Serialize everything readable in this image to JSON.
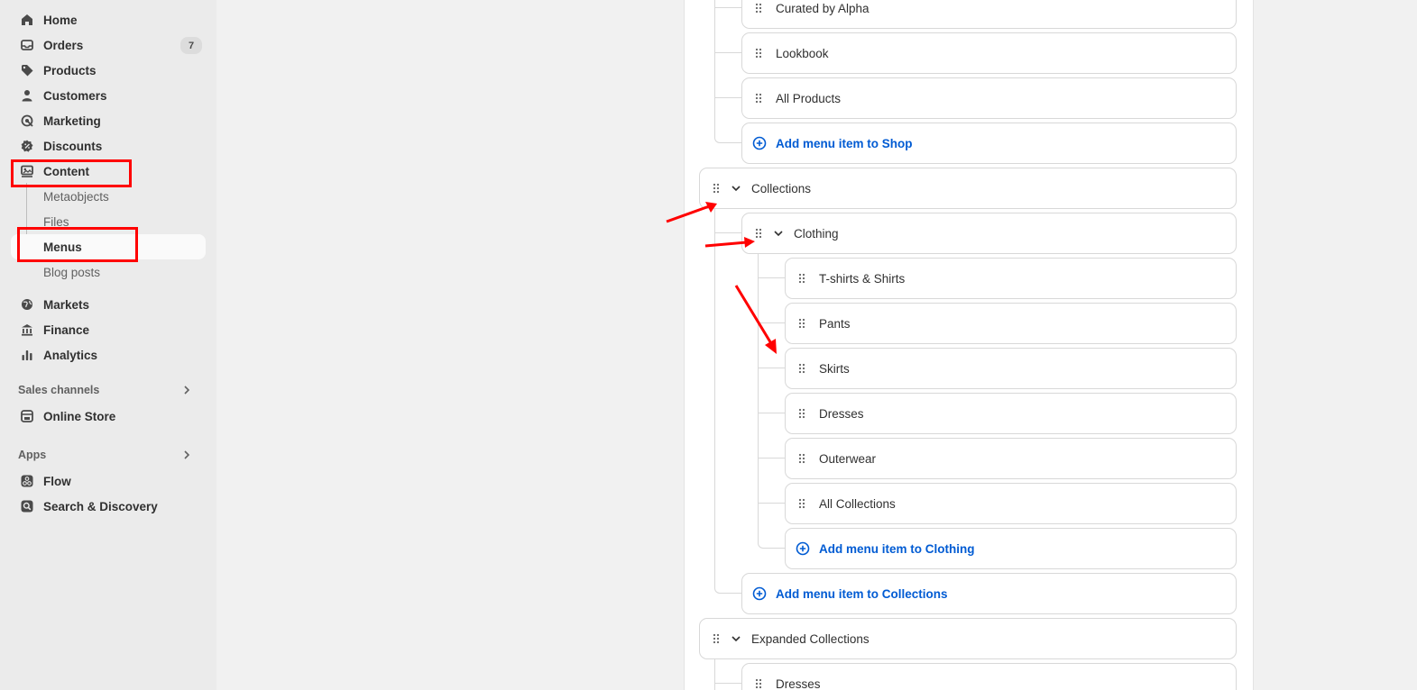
{
  "sidebar": {
    "nav": [
      {
        "label": "Home",
        "icon": "home-icon"
      },
      {
        "label": "Orders",
        "icon": "inbox-icon",
        "badge": "7"
      },
      {
        "label": "Products",
        "icon": "tag-icon"
      },
      {
        "label": "Customers",
        "icon": "person-icon"
      },
      {
        "label": "Marketing",
        "icon": "target-icon"
      },
      {
        "label": "Discounts",
        "icon": "discount-icon"
      },
      {
        "label": "Content",
        "icon": "content-icon"
      }
    ],
    "content_sub": [
      "Metaobjects",
      "Files",
      "Menus",
      "Blog posts"
    ],
    "nav2": [
      {
        "label": "Markets",
        "icon": "globe-icon"
      },
      {
        "label": "Finance",
        "icon": "bank-icon"
      },
      {
        "label": "Analytics",
        "icon": "bar-chart-icon"
      }
    ],
    "sales_channels": {
      "heading": "Sales channels",
      "items": [
        {
          "label": "Online Store",
          "icon": "store-icon"
        }
      ]
    },
    "apps": {
      "heading": "Apps",
      "items": [
        {
          "label": "Flow",
          "icon": "flow-icon"
        },
        {
          "label": "Search & Discovery",
          "icon": "search-discovery-icon"
        }
      ]
    }
  },
  "menu_tree": {
    "shop_children": [
      "Curated by Alpha",
      "Lookbook",
      "All Products"
    ],
    "add_shop": "Add menu item to Shop",
    "collections": "Collections",
    "clothing": "Clothing",
    "clothing_children": [
      "T-shirts & Shirts",
      "Pants",
      "Skirts",
      "Dresses",
      "Outerwear",
      "All Collections"
    ],
    "add_clothing": "Add menu item to Clothing",
    "add_collections": "Add menu item to Collections",
    "expanded_collections": "Expanded Collections",
    "expanded_children": [
      "Dresses"
    ]
  },
  "colors": {
    "link": "#005bd3",
    "annotation": "#ff0000"
  }
}
